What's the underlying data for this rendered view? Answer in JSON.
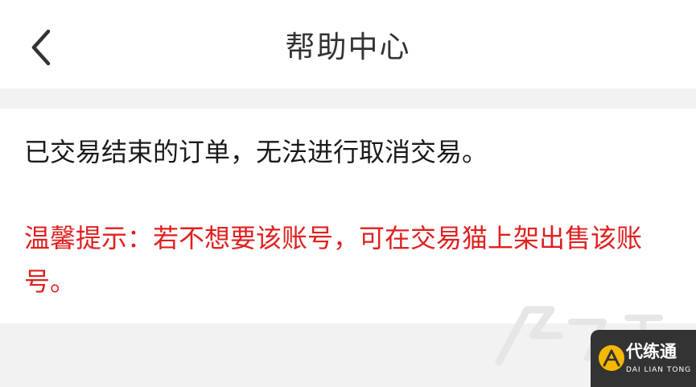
{
  "header": {
    "title": "帮助中心",
    "back_icon": "chevron-left-icon"
  },
  "content": {
    "main_text": "已交易结束的订单，无法进行取消交易。",
    "tip_text": "温馨提示：若不想要该账号，可在交易猫上架出售该账号。",
    "tip_color": "#e02020"
  },
  "watermark": {
    "brand_name": "代练通",
    "brand_sub": "DAI LIAN TONG",
    "logo_icon": "daliantong-logo-icon"
  }
}
